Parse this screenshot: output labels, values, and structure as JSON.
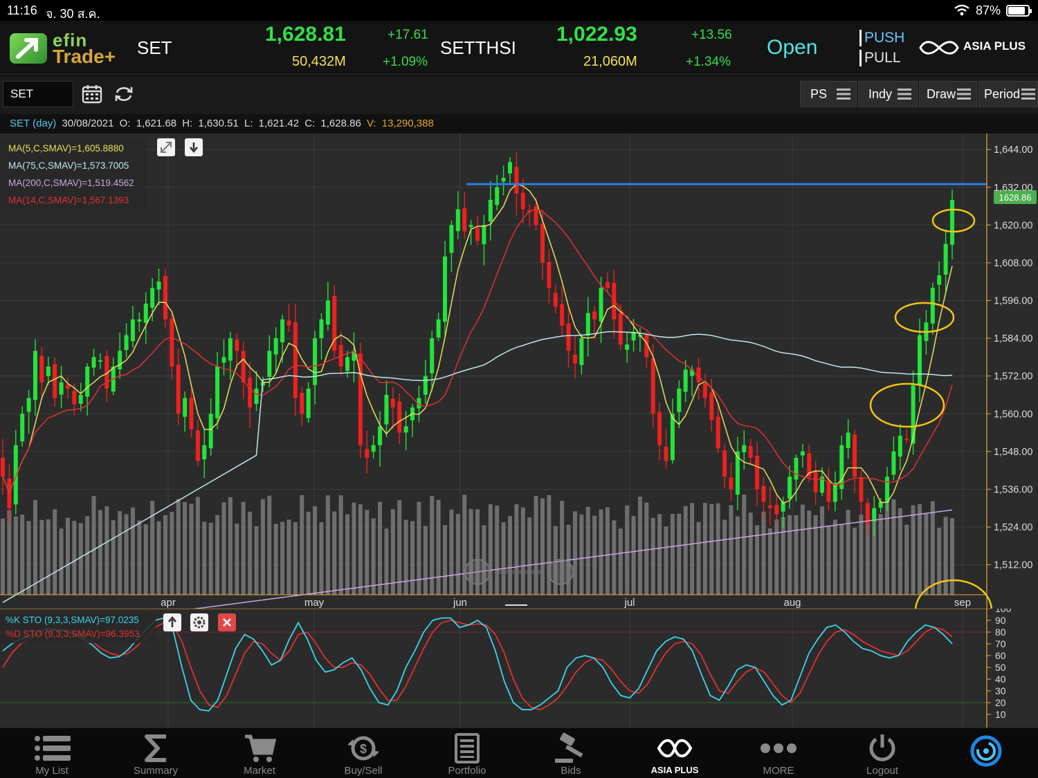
{
  "status_bar": {
    "time": "11:16",
    "date": "จ. 30 ส.ค.",
    "battery": "87%",
    "battery_level": 0.87
  },
  "header": {
    "logo_line1": "efin",
    "logo_line2": "Trade+",
    "indices": [
      {
        "name": "SET",
        "last": "1,628.81",
        "volume": "50,432M",
        "change": "+17.61",
        "pct_change": "+1.09%"
      },
      {
        "name": "SETTHSI",
        "last": "1,022.93",
        "volume": "21,060M",
        "change": "+13.56",
        "pct_change": "+1.34%"
      }
    ],
    "market_status": "Open",
    "push_label": "PUSH",
    "pull_label": "PULL",
    "broker": "ASIA PLUS"
  },
  "toolbar": {
    "symbol": "SET",
    "buttons": [
      {
        "label": "PS"
      },
      {
        "label": "Indy"
      },
      {
        "label": "Draw"
      },
      {
        "label": "Period"
      }
    ]
  },
  "info": {
    "title": "SET (day)",
    "date": "30/08/2021",
    "o_label": "O:",
    "o": "1,621.68",
    "h_label": "H:",
    "h": "1,630.51",
    "l_label": "L:",
    "l": "1,621.42",
    "c_label": "C:",
    "c": "1,628.86",
    "v_label": "V:",
    "v": "13,290,388"
  },
  "indicators": [
    {
      "label": "MA(5,C,SMAV)=1,605.8880",
      "color": "#e6e05a"
    },
    {
      "label": "MA(75,C,SMAV)=1,573.7005",
      "color": "#bfe8ea"
    },
    {
      "label": "MA(200,C,SMAV)=1,519.4562",
      "color": "#c9a8e0"
    },
    {
      "label": "MA(14,C,SMAV)=1,567.1393",
      "color": "#e23030"
    }
  ],
  "sto": {
    "k_label": "%K STO (9,3,3,SMAV)=97.0235",
    "d_label": "%D STO (9,3,3,SMAV)=96.3953",
    "k_color": "#3fd4ea",
    "d_color": "#e23030"
  },
  "colors": {
    "up": "#22e43a",
    "down": "#ee2020",
    "volume": "#7a7a7a",
    "resistance": "#2f7ee8",
    "annotation": "#f5c518"
  },
  "chart_data": {
    "type": "candlestick",
    "title": "SET (day)",
    "y_ticks": [
      "1,644.00",
      "1,632.00",
      "1,620.00",
      "1,608.00",
      "1,596.00",
      "1,584.00",
      "1,572.00",
      "1,560.00",
      "1,548.00",
      "1,536.00",
      "1,524.00",
      "1,512.00"
    ],
    "ylim": [
      1504,
      1648
    ],
    "x_labels": [
      "apr",
      "may",
      "jun",
      "jul",
      "aug",
      "sep"
    ],
    "last_price_label": "1628.86",
    "resistance_level": 1633,
    "closes": [
      1540,
      1530,
      1550,
      1560,
      1565,
      1580,
      1570,
      1575,
      1565,
      1570,
      1568,
      1563,
      1566,
      1575,
      1578,
      1577,
      1568,
      1575,
      1580,
      1585,
      1590,
      1590,
      1595,
      1600,
      1602,
      1590,
      1575,
      1560,
      1565,
      1555,
      1545,
      1550,
      1560,
      1575,
      1578,
      1584,
      1580,
      1570,
      1562,
      1568,
      1570,
      1580,
      1584,
      1590,
      1588,
      1565,
      1560,
      1568,
      1584,
      1590,
      1596,
      1580,
      1575,
      1578,
      1580,
      1550,
      1546,
      1550,
      1556,
      1566,
      1562,
      1554,
      1556,
      1562,
      1565,
      1572,
      1584,
      1590,
      1610,
      1620,
      1625,
      1618,
      1620,
      1615,
      1620,
      1628,
      1632,
      1635,
      1640,
      1630,
      1625,
      1624,
      1620,
      1608,
      1600,
      1594,
      1588,
      1580,
      1576,
      1584,
      1592,
      1590,
      1600,
      1600,
      1590,
      1582,
      1582,
      1586,
      1585,
      1578,
      1560,
      1550,
      1545,
      1560,
      1568,
      1574,
      1574,
      1570,
      1565,
      1558,
      1549,
      1540,
      1536,
      1548,
      1550,
      1546,
      1536,
      1532,
      1530,
      1528,
      1532,
      1540,
      1546,
      1548,
      1540,
      1535,
      1540,
      1532,
      1538,
      1550,
      1554,
      1540,
      1532,
      1525,
      1530,
      1532,
      1540,
      1548,
      1553,
      1552,
      1569,
      1585,
      1589,
      1600,
      1604,
      1614,
      1628
    ],
    "k_line": [
      64,
      70,
      74,
      76,
      80,
      83,
      82,
      81,
      78,
      74,
      69,
      62,
      58,
      59,
      65,
      74,
      82,
      90,
      92,
      82,
      50,
      22,
      14,
      13,
      22,
      44,
      66,
      78,
      74,
      64,
      52,
      56,
      74,
      88,
      74,
      56,
      46,
      48,
      54,
      58,
      48,
      32,
      20,
      18,
      30,
      50,
      64,
      80,
      90,
      92,
      92,
      84,
      86,
      90,
      84,
      64,
      38,
      20,
      14,
      14,
      18,
      24,
      30,
      50,
      58,
      60,
      58,
      50,
      36,
      26,
      24,
      32,
      48,
      64,
      72,
      76,
      74,
      64,
      44,
      26,
      22,
      34,
      48,
      52,
      50,
      38,
      26,
      18,
      22,
      42,
      62,
      74,
      84,
      86,
      80,
      72,
      66,
      64,
      60,
      58,
      60,
      72,
      80,
      86,
      84,
      78,
      70
    ],
    "d_line": [
      50,
      62,
      70,
      74,
      78,
      80,
      82,
      82,
      80,
      76,
      72,
      66,
      62,
      60,
      62,
      68,
      76,
      84,
      88,
      86,
      72,
      50,
      30,
      18,
      16,
      26,
      44,
      62,
      72,
      70,
      62,
      56,
      64,
      78,
      80,
      70,
      58,
      50,
      50,
      54,
      52,
      44,
      32,
      22,
      22,
      34,
      50,
      66,
      80,
      88,
      90,
      88,
      86,
      87,
      86,
      78,
      62,
      40,
      24,
      16,
      14,
      18,
      24,
      34,
      46,
      54,
      58,
      56,
      48,
      38,
      30,
      28,
      36,
      50,
      62,
      70,
      72,
      70,
      60,
      44,
      30,
      28,
      38,
      46,
      50,
      46,
      36,
      26,
      20,
      28,
      44,
      60,
      72,
      80,
      82,
      78,
      72,
      68,
      64,
      62,
      60,
      64,
      72,
      80,
      84,
      82,
      76
    ],
    "sto_ticks": [
      "100",
      "90",
      "80",
      "70",
      "60",
      "50",
      "40",
      "30",
      "20",
      "10"
    ]
  }
}
